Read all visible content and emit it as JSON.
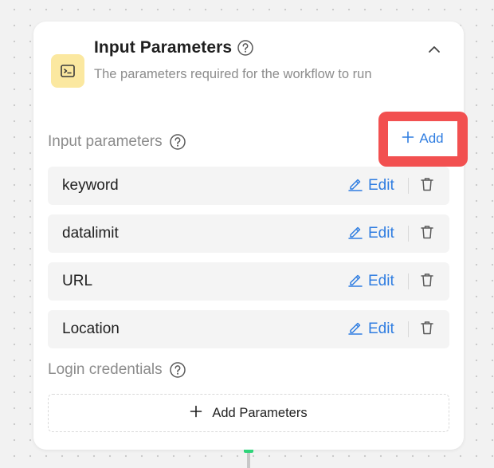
{
  "node": {
    "title": "Input Parameters",
    "subtitle": "The parameters required for the workflow to run",
    "icon": "terminal-icon",
    "icon_bg": "#fbe8a0"
  },
  "input_section": {
    "label": "Input parameters",
    "add_label": "Add",
    "parameters": [
      {
        "name": "keyword",
        "edit_label": "Edit"
      },
      {
        "name": "datalimit",
        "edit_label": "Edit"
      },
      {
        "name": "URL",
        "edit_label": "Edit"
      },
      {
        "name": "Location",
        "edit_label": "Edit"
      }
    ]
  },
  "login_section": {
    "label": "Login credentials",
    "add_label": "Add Parameters"
  },
  "colors": {
    "accent": "#2f7de1",
    "highlight": "#f25050",
    "muted_text": "#8c8c8c",
    "row_bg": "#f4f4f4",
    "connector": "#2fd47a"
  }
}
